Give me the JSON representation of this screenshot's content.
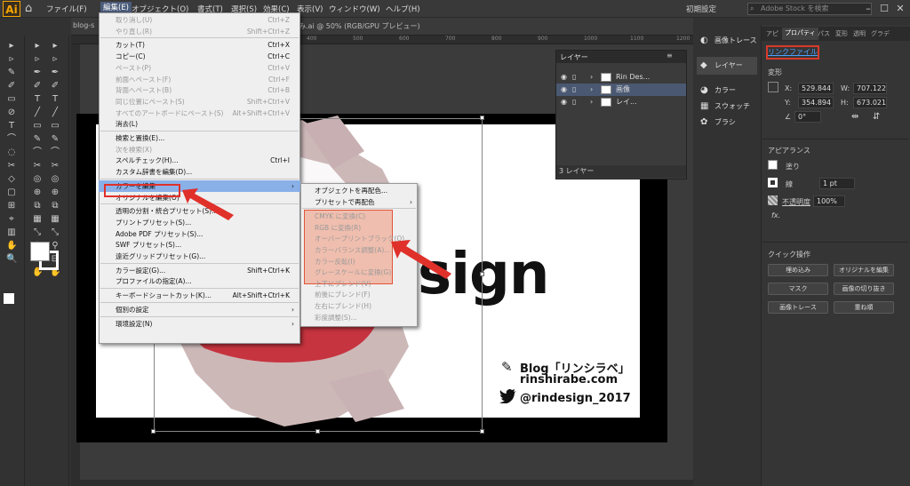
{
  "menubar": {
    "items": [
      "ファイル(F)",
      "編集(E)",
      "オブジェクト(O)",
      "書式(T)",
      "選択(S)",
      "効果(C)",
      "表示(V)",
      "ウィンドウ(W)",
      "ヘルプ(H)"
    ],
    "workspace": "初期設定",
    "stock_placeholder": "Adobe Stock を検索",
    "app_logo": "Ai"
  },
  "document": {
    "tab_left": "blog-s",
    "tab_title": "み.ai @ 50% (RGB/GPU プレビュー)",
    "ruler_ticks": [
      "400",
      "500",
      "600",
      "700",
      "800",
      "900",
      "1000",
      "1100",
      "1200"
    ]
  },
  "artwork": {
    "sign_text": "sign",
    "blog_label": "Blog「リンシラベ」",
    "site_label": "rinshirabe.com",
    "twitter_label": "@rindesign_2017"
  },
  "edit_menu": {
    "items": [
      {
        "label": "取り消し(U)",
        "shortcut": "Ctrl+Z",
        "disabled": true
      },
      {
        "label": "やり直し(R)",
        "shortcut": "Shift+Ctrl+Z",
        "disabled": true
      },
      {
        "sep": true
      },
      {
        "label": "カット(T)",
        "shortcut": "Ctrl+X"
      },
      {
        "label": "コピー(C)",
        "shortcut": "Ctrl+C"
      },
      {
        "label": "ペースト(P)",
        "shortcut": "Ctrl+V",
        "disabled": true
      },
      {
        "label": "前面へペースト(F)",
        "shortcut": "Ctrl+F",
        "disabled": true
      },
      {
        "label": "背面へペースト(B)",
        "shortcut": "Ctrl+B",
        "disabled": true
      },
      {
        "label": "同じ位置にペースト(S)",
        "shortcut": "Shift+Ctrl+V",
        "disabled": true
      },
      {
        "label": "すべてのアートボードにペースト(S)",
        "shortcut": "Alt+Shift+Ctrl+V",
        "disabled": true
      },
      {
        "label": "消去(L)",
        "shortcut": ""
      },
      {
        "sep": true
      },
      {
        "label": "検索と置換(E)...",
        "shortcut": ""
      },
      {
        "label": "次を検索(X)",
        "shortcut": "",
        "disabled": true
      },
      {
        "label": "スペルチェック(H)...",
        "shortcut": "Ctrl+I"
      },
      {
        "label": "カスタム辞書を編集(D)...",
        "shortcut": ""
      },
      {
        "sep": true
      },
      {
        "label": "カラーを編集",
        "shortcut": "",
        "submenu": true,
        "highlight": true
      },
      {
        "label": "オリジナルを編集(O)",
        "shortcut": ""
      },
      {
        "sep": true
      },
      {
        "label": "透明の分割・統合プリセット(S)...",
        "shortcut": ""
      },
      {
        "label": "プリントプリセット(S)...",
        "shortcut": ""
      },
      {
        "label": "Adobe PDF プリセット(S)...",
        "shortcut": ""
      },
      {
        "label": "SWF プリセット(S)...",
        "shortcut": ""
      },
      {
        "label": "遠近グリッドプリセット(G)...",
        "shortcut": ""
      },
      {
        "sep": true
      },
      {
        "label": "カラー設定(G)...",
        "shortcut": "Shift+Ctrl+K"
      },
      {
        "label": "プロファイルの指定(A)...",
        "shortcut": ""
      },
      {
        "sep": true
      },
      {
        "label": "キーボードショートカット(K)...",
        "shortcut": "Alt+Shift+Ctrl+K"
      },
      {
        "sep": true
      },
      {
        "label": "個別の設定",
        "shortcut": "",
        "submenu": true
      },
      {
        "sep": true
      },
      {
        "label": "環境設定(N)",
        "shortcut": "",
        "submenu": true
      }
    ]
  },
  "color_submenu": {
    "items": [
      {
        "label": "オブジェクトを再配色..."
      },
      {
        "label": "プリセットで再配色",
        "submenu": true
      },
      {
        "sep": true
      },
      {
        "label": "CMYK に変換(C)",
        "disabled": true
      },
      {
        "label": "RGB に変換(R)",
        "disabled": true
      },
      {
        "label": "オーバープリントブラック(O)...",
        "disabled": true
      },
      {
        "label": "カラーバランス調整(A)...",
        "disabled": true
      },
      {
        "label": "カラー反転(I)",
        "disabled": true
      },
      {
        "label": "グレースケールに変換(G)",
        "disabled": true
      },
      {
        "label": "上下にブレンド(V)",
        "disabled": true
      },
      {
        "label": "前後にブレンド(F)",
        "disabled": true
      },
      {
        "label": "左右にブレンド(H)",
        "disabled": true
      },
      {
        "label": "彩度調整(S)...",
        "disabled": true
      }
    ]
  },
  "layers_panel": {
    "title": "レイヤー",
    "rows": [
      "Rin Des...",
      "画像",
      "レイ..."
    ],
    "footer": "3 レイヤー"
  },
  "right_dock": {
    "items": [
      "画像トレース",
      "レイヤー",
      "カラー",
      "スウォッチ",
      "ブラシ"
    ]
  },
  "properties": {
    "tabs": [
      "アピ",
      "プロパティ",
      "パス",
      "変形",
      "透明",
      "グラデ"
    ],
    "linked_file": "リンクファイル",
    "transform_label": "変形",
    "x_label": "X:",
    "x_value": "529.844",
    "y_label": "Y:",
    "y_value": "354.894",
    "w_label": "W:",
    "w_value": "707.122",
    "h_label": "H:",
    "h_value": "673.021",
    "angle": "0°",
    "appearance_label": "アピアランス",
    "fill_label": "塗り",
    "stroke_label": "線",
    "stroke_value": "1 pt",
    "opacity_label": "不透明度",
    "opacity_value": "100%",
    "fx": "fx.",
    "quick_label": "クイック操作",
    "btn_embed": "埋め込み",
    "btn_edit_original": "オリジナルを編集",
    "btn_mask": "マスク",
    "btn_crop": "画像の切り抜き",
    "btn_trace": "画像トレース",
    "btn_arrange": "重ね順"
  },
  "colors": {
    "accent_red": "#e0302a",
    "menu_bg": "#efefef",
    "highlight_blue": "#8ab0e8"
  }
}
